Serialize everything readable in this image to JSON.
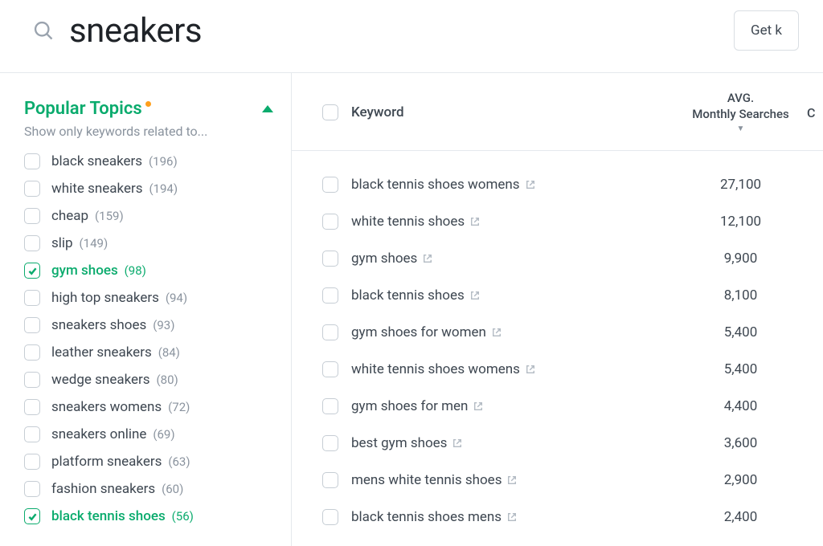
{
  "search": {
    "value": "sneakers"
  },
  "cta": {
    "label": "Get k"
  },
  "sidebar": {
    "title": "Popular Topics",
    "subtitle": "Show only keywords related to...",
    "topics": [
      {
        "label": "black sneakers",
        "count": "(196)",
        "checked": false
      },
      {
        "label": "white sneakers",
        "count": "(194)",
        "checked": false
      },
      {
        "label": "cheap",
        "count": "(159)",
        "checked": false
      },
      {
        "label": "slip",
        "count": "(149)",
        "checked": false
      },
      {
        "label": "gym shoes",
        "count": "(98)",
        "checked": true
      },
      {
        "label": "high top sneakers",
        "count": "(94)",
        "checked": false
      },
      {
        "label": "sneakers shoes",
        "count": "(93)",
        "checked": false
      },
      {
        "label": "leather sneakers",
        "count": "(84)",
        "checked": false
      },
      {
        "label": "wedge sneakers",
        "count": "(80)",
        "checked": false
      },
      {
        "label": "sneakers womens",
        "count": "(72)",
        "checked": false
      },
      {
        "label": "sneakers online",
        "count": "(69)",
        "checked": false
      },
      {
        "label": "platform sneakers",
        "count": "(63)",
        "checked": false
      },
      {
        "label": "fashion sneakers",
        "count": "(60)",
        "checked": false
      },
      {
        "label": "black tennis shoes",
        "count": "(56)",
        "checked": true
      }
    ]
  },
  "table": {
    "headers": {
      "keyword": "Keyword",
      "searches_line1": "AVG.",
      "searches_line2": "Monthly Searches",
      "last": "C"
    },
    "rows": [
      {
        "keyword": "black tennis shoes womens",
        "searches": "27,100"
      },
      {
        "keyword": "white tennis shoes",
        "searches": "12,100"
      },
      {
        "keyword": "gym shoes",
        "searches": "9,900"
      },
      {
        "keyword": "black tennis shoes",
        "searches": "8,100"
      },
      {
        "keyword": "gym shoes for women",
        "searches": "5,400"
      },
      {
        "keyword": "white tennis shoes womens",
        "searches": "5,400"
      },
      {
        "keyword": "gym shoes for men",
        "searches": "4,400"
      },
      {
        "keyword": "best gym shoes",
        "searches": "3,600"
      },
      {
        "keyword": "mens white tennis shoes",
        "searches": "2,900"
      },
      {
        "keyword": "black tennis shoes mens",
        "searches": "2,400"
      }
    ]
  }
}
